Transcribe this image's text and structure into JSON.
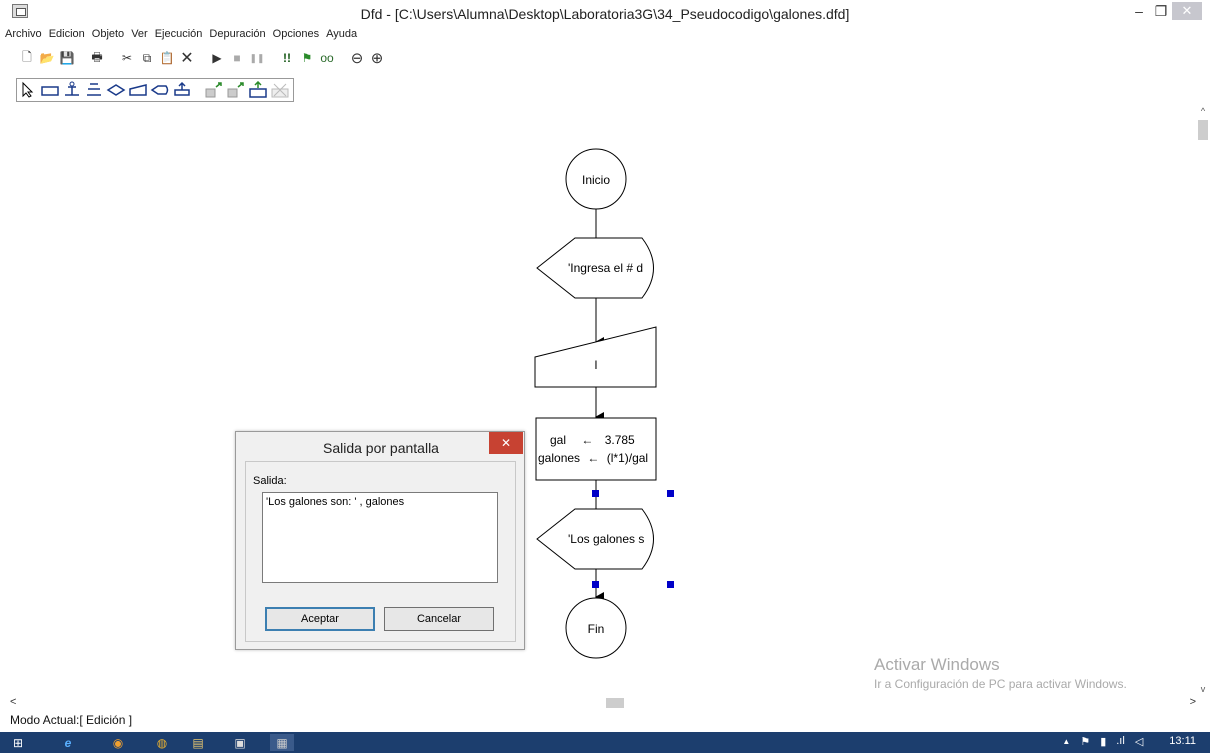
{
  "window": {
    "title": "Dfd - [C:\\Users\\Alumna\\Desktop\\Laboratoria3G\\34_Pseudocodigo\\galones.dfd]",
    "min_glyph": "–",
    "max_glyph": "❐",
    "close_glyph": "✕"
  },
  "menu": [
    "Archivo",
    "Edicion",
    "Objeto",
    "Ver",
    "Ejecución",
    "Depuración",
    "Opciones",
    "Ayuda"
  ],
  "toolbar": {
    "new_glyph": "🗋",
    "open_glyph": "📂",
    "save_glyph": "💾",
    "print_glyph": "🖶",
    "cut_glyph": "✂",
    "copy_glyph": "⧉",
    "paste_glyph": "📋",
    "delete_glyph": "✕",
    "run_glyph": "▶",
    "stop_glyph": "■",
    "pause_glyph": "❚❚",
    "debug_glyph": "!!",
    "step_glyph": "⚑",
    "watch_glyph": "oo",
    "zoom_out_glyph": "⊖",
    "zoom_in_glyph": "⊕"
  },
  "flowchart": {
    "start": "Inicio",
    "output1": "'Ingresa el # d",
    "input1": "l",
    "assign_line1_var": "gal",
    "assign_line1_val": "3.785",
    "assign_line2_var": "galones",
    "assign_line2_val": "(l*1)/gal",
    "output2": "'Los galones s",
    "end": "Fin",
    "arrow_glyph": "←"
  },
  "dialog": {
    "title": "Salida por pantalla",
    "close_glyph": "✕",
    "label": "Salida:",
    "value": "'Los galones son: ' , galones",
    "ok": "Aceptar",
    "cancel": "Cancelar"
  },
  "scroll": {
    "up_glyph": "^",
    "down_glyph": "v",
    "left_glyph": "<",
    "right_glyph": ">"
  },
  "watermark": {
    "title": "Activar Windows",
    "subtitle": "Ir a Configuración de PC para activar Windows."
  },
  "status": "Modo Actual:[ Edición ]",
  "taskbar": {
    "start_glyph": "⊞",
    "ie_glyph": "e",
    "app2_glyph": "◉",
    "chrome_glyph": "◍",
    "files_glyph": "▤",
    "app5_glyph": "▣",
    "dfd_glyph": "▦",
    "tray_up": "▲",
    "tray_flag": "⚑",
    "tray_net": "▮",
    "tray_signal": ".ıl",
    "tray_vol": "◁",
    "clock": "13:11"
  },
  "colors": {
    "handle": "#0000c8",
    "taskbar": "#1c3e6e",
    "close_red": "#c74232"
  }
}
